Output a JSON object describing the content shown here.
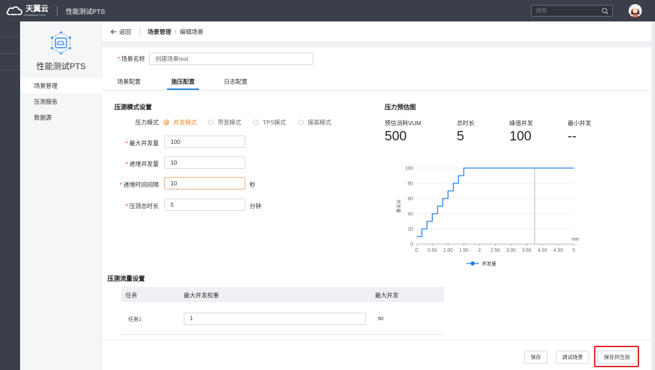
{
  "topbar": {
    "brand": "天翼云",
    "brand_sub": "Chinatelecom Cloud",
    "product": "性能测试PTS",
    "search_placeholder": "搜索"
  },
  "sidebar": {
    "title": "性能测试PTS",
    "items": [
      {
        "label": "场景管理",
        "active": true
      },
      {
        "label": "压测报告",
        "active": false
      },
      {
        "label": "数据源",
        "active": false
      }
    ]
  },
  "breadcrumb": {
    "back_label": "返回",
    "level1": "场景管理",
    "separator": "/",
    "level2": "编辑场景"
  },
  "scene_name": {
    "label": "场景名称",
    "value": "创建场景test"
  },
  "tabs": [
    {
      "label": "场景配置",
      "active": false
    },
    {
      "label": "施压配置",
      "active": true
    },
    {
      "label": "日志配置",
      "active": false
    }
  ],
  "pressure_mode": {
    "section_title": "压测模式设置",
    "mode_label": "压力模式",
    "options": [
      {
        "label": "并发模式",
        "checked": true
      },
      {
        "label": "带宽模式",
        "checked": false
      },
      {
        "label": "TPS模式",
        "checked": false
      },
      {
        "label": "摸高模式",
        "checked": false
      }
    ],
    "max_concurrency": {
      "label": "最大并发量",
      "value": "100"
    },
    "step_concurrency": {
      "label": "递增并发量",
      "value": "10"
    },
    "step_interval": {
      "label": "递增时间间隔",
      "value": "10",
      "unit": "秒"
    },
    "duration": {
      "label": "压测总时长",
      "value": "5",
      "unit": "分钟"
    }
  },
  "estimate": {
    "title": "压力预估图",
    "stats": [
      {
        "label": "预估消耗VUM",
        "value": "500"
      },
      {
        "label": "总时长",
        "value": "5"
      },
      {
        "label": "峰值并发",
        "value": "100"
      },
      {
        "label": "最小并发",
        "value": "--"
      }
    ]
  },
  "chart_data": {
    "type": "line",
    "ylabel": "并发量",
    "xlabel": "min",
    "x_ticks": [
      "0",
      "0.50",
      "1.00",
      "1.50",
      "2",
      "2.50",
      "3.00",
      "3.50",
      "4.00",
      "4.50",
      "5"
    ],
    "y_ticks": [
      "0",
      "20",
      "40",
      "60",
      "80",
      "100"
    ],
    "xlim": [
      0,
      5
    ],
    "ylim": [
      0,
      100
    ],
    "marker_x": 3.75,
    "series": [
      {
        "name": "并发量",
        "color": "#1e7ee6",
        "step": true,
        "x": [
          0,
          0.17,
          0.33,
          0.5,
          0.67,
          0.83,
          1.0,
          1.17,
          1.33,
          1.5,
          5.0
        ],
        "y": [
          10,
          20,
          30,
          40,
          50,
          60,
          70,
          80,
          90,
          100,
          100
        ]
      }
    ],
    "legend": "bottom",
    "grid": true
  },
  "traffic": {
    "section_title": "压测流量设置",
    "columns": [
      "任务",
      "最大并发权重",
      "最大并发"
    ],
    "rows": [
      {
        "task": "任务1",
        "weight": "1",
        "max": "50"
      }
    ]
  },
  "footer": {
    "save": "保存",
    "debug": "调试场景",
    "save_run": "保存并压测"
  }
}
